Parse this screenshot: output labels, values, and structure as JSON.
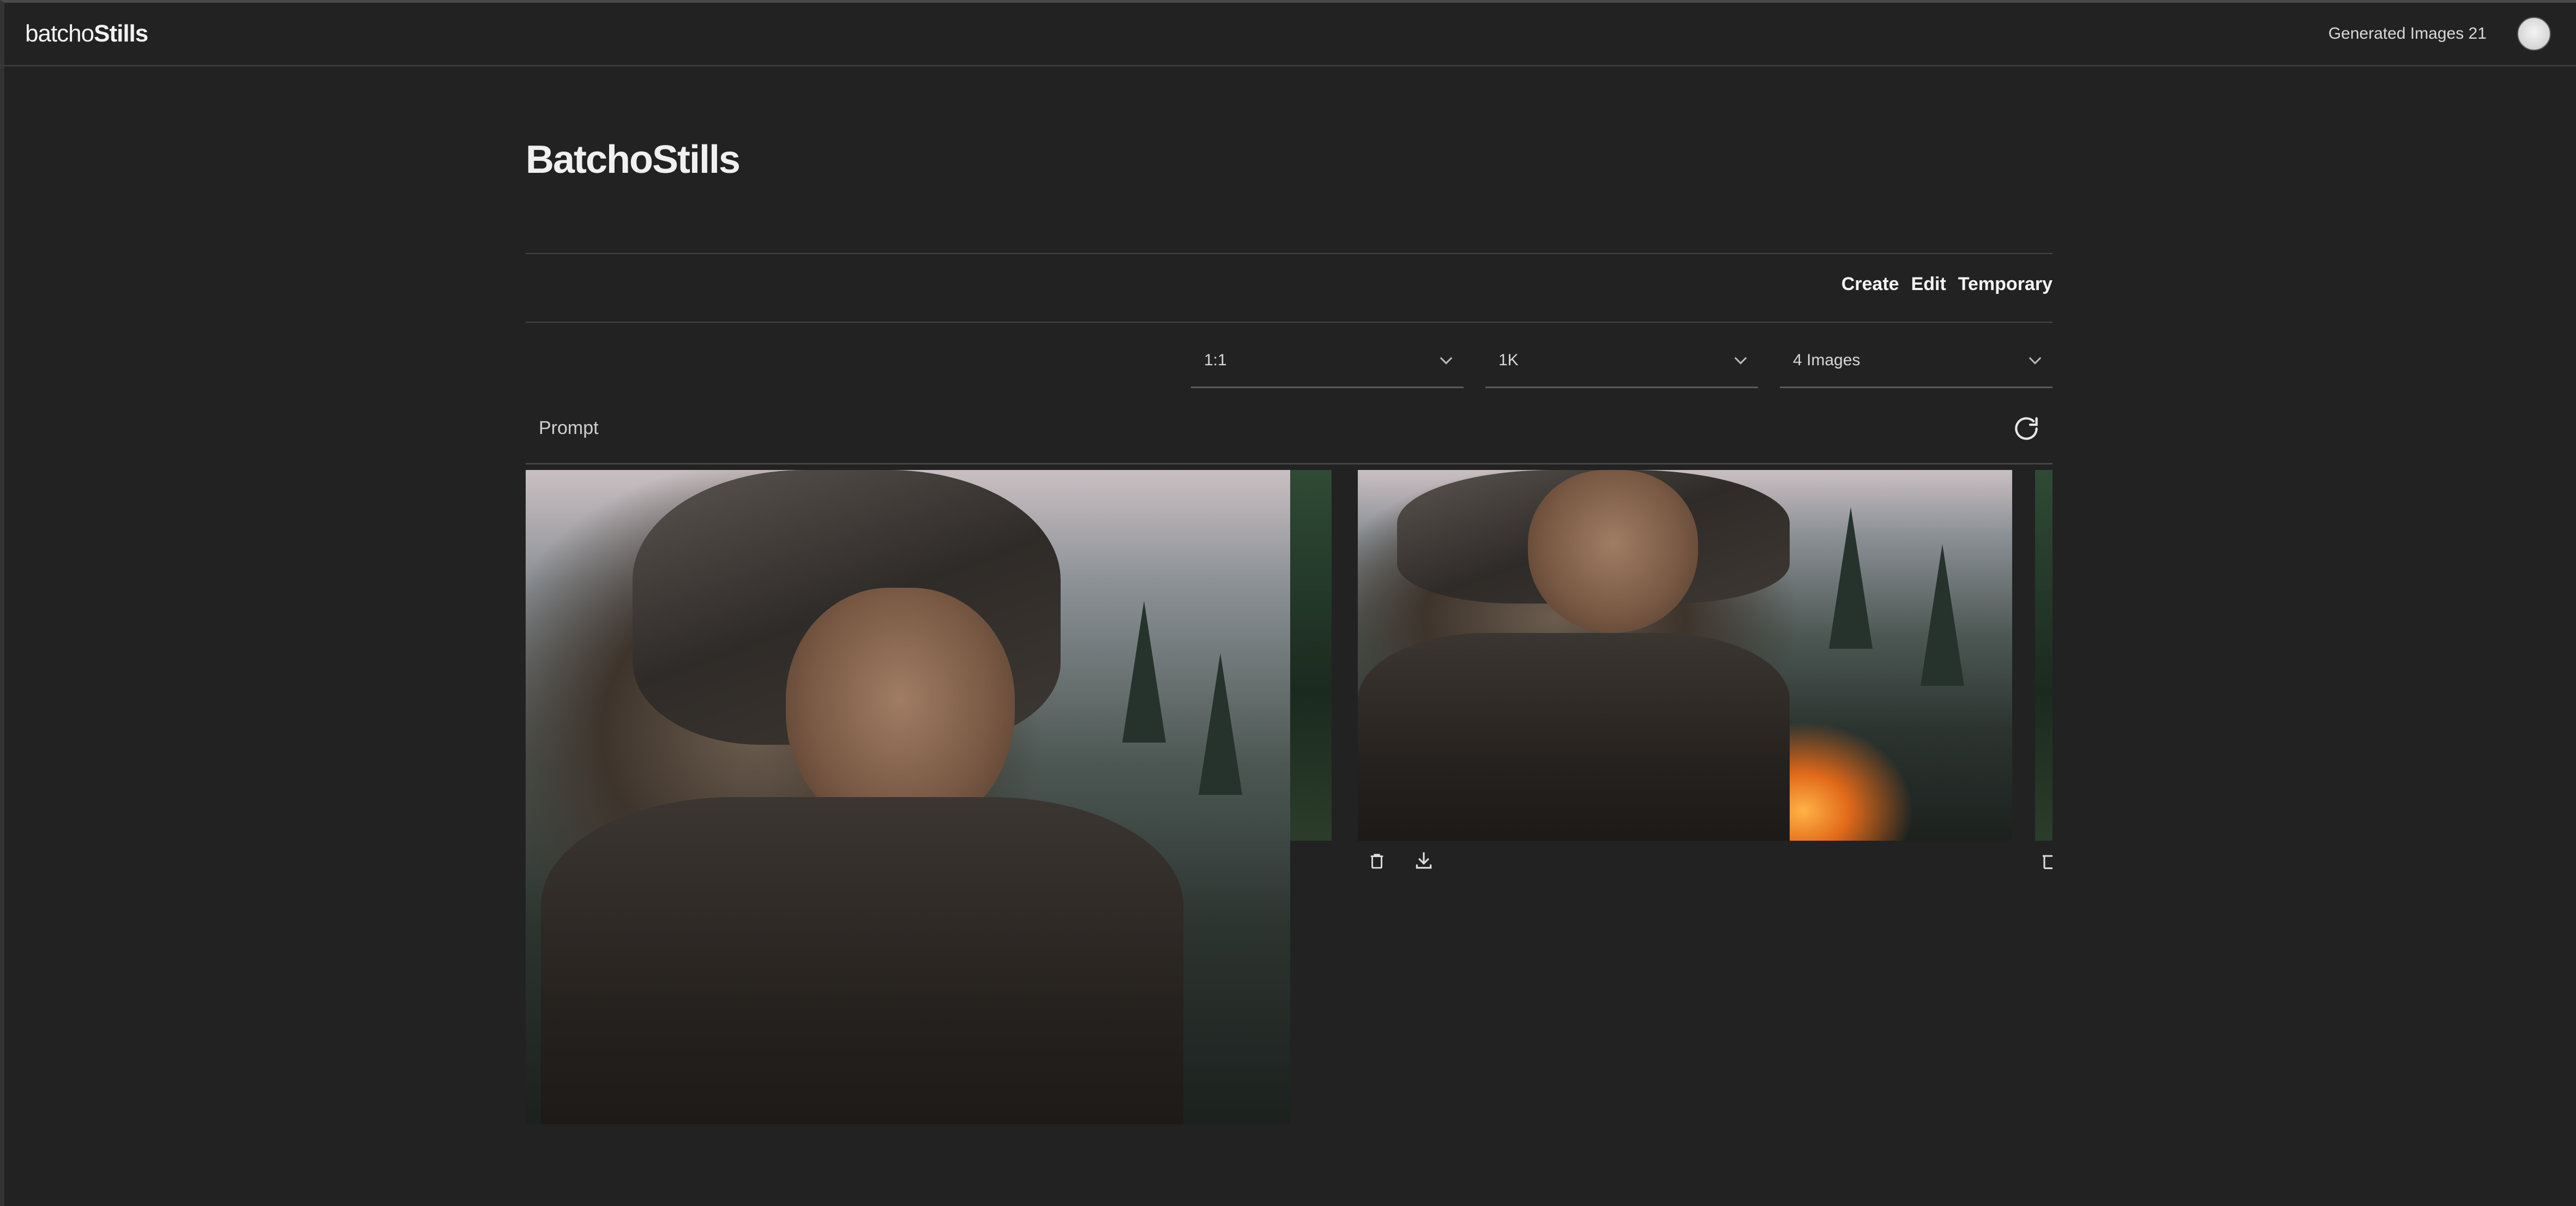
{
  "app": {
    "brand_light": "batcho",
    "brand_bold": "Stills"
  },
  "header": {
    "generated_label": "Generated Images 21"
  },
  "main": {
    "title": "BatchoStills",
    "modes": [
      "Create",
      "Edit",
      "Temporary"
    ],
    "selects": {
      "aspect": "1:1",
      "resolution": "1K",
      "count": "4 Images"
    },
    "prompt": {
      "placeholder": "Prompt"
    }
  },
  "icons": {
    "refresh": "refresh-icon",
    "trash": "trash-icon",
    "download": "download-icon",
    "avatar": "avatar"
  },
  "colors": {
    "background": "#222222",
    "text": "#e8e8e8",
    "divider": "#444444"
  }
}
